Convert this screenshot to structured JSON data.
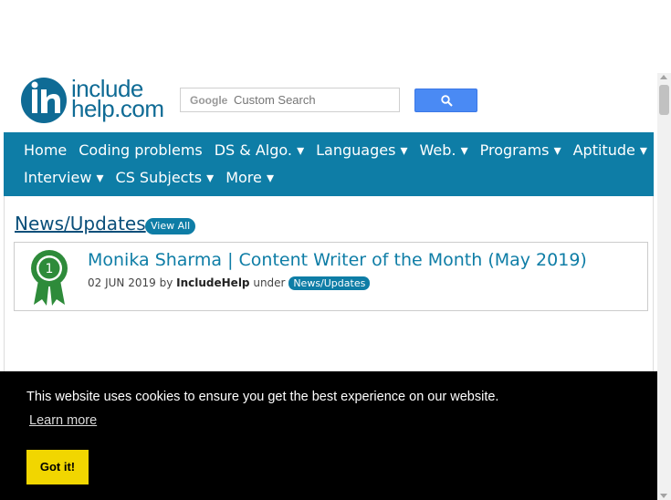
{
  "header": {
    "logo": {
      "line1": "include",
      "line2": "help.com"
    },
    "search": {
      "brand": "Google",
      "placeholder": "Custom Search"
    }
  },
  "nav": {
    "row1": [
      "Home",
      "Coding problems",
      "DS & Algo. ▾",
      "Languages ▾",
      "Web. ▾",
      "Programs ▾",
      "Aptitude ▾"
    ],
    "row2": [
      "Interview ▾",
      "CS Subjects ▾",
      "More ▾"
    ]
  },
  "section": {
    "title": "News/Updates",
    "view_all": "View All"
  },
  "article": {
    "title": "Monika Sharma | Content Writer of the Month (May 2019)",
    "date": "02 JUN 2019",
    "by": "by",
    "author": "IncludeHelp",
    "under": "under",
    "tag": "News/Updates",
    "badge_number": "1"
  },
  "cookie": {
    "message": "This website uses cookies to ensure you get the best experience on our website.",
    "learn_more": "Learn more",
    "button": "Got it!"
  },
  "colors": {
    "brand": "#0e7da6",
    "cookie_bg": "#000000",
    "cookie_button": "#f1d600",
    "badge_green": "#2e8b3a"
  }
}
